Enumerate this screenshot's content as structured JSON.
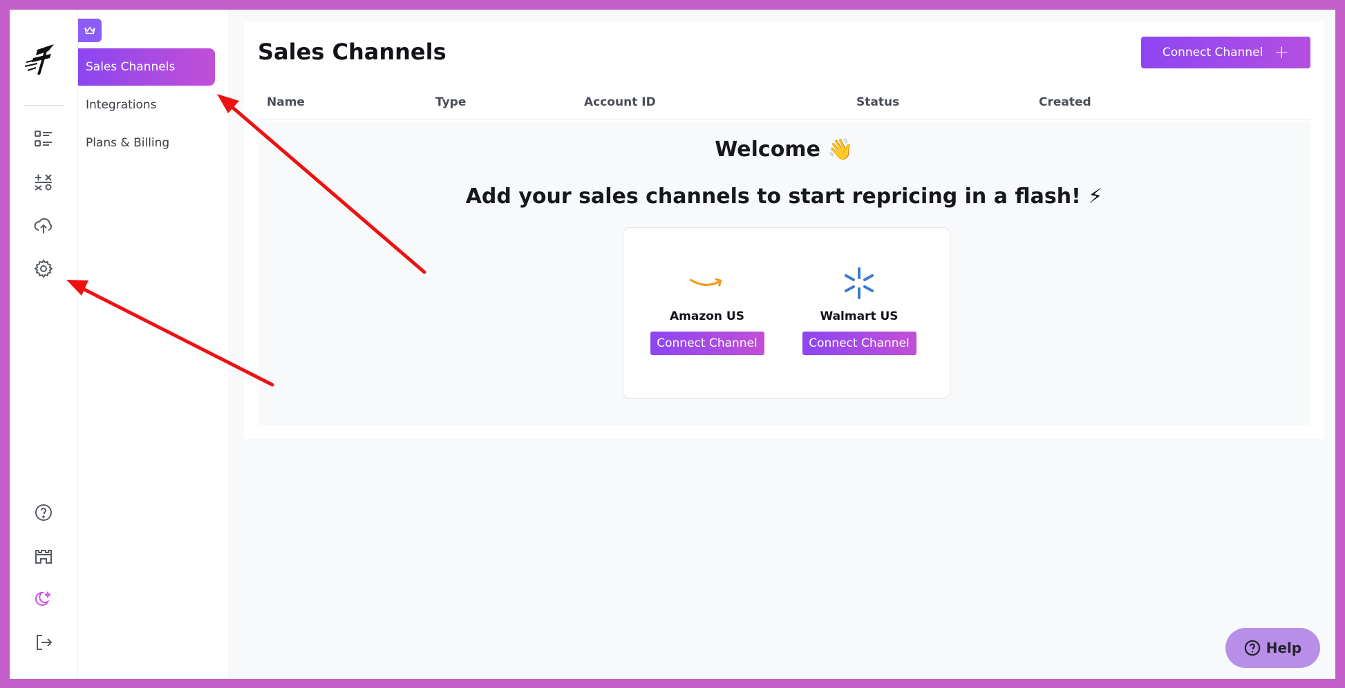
{
  "sidebar": {
    "icons": [
      "logo-icon",
      "list-icon",
      "calculator-icon",
      "upload-cloud-icon",
      "settings-gear-icon",
      "help-circle-icon",
      "castle-icon",
      "moon-icon",
      "logout-icon"
    ]
  },
  "submenu": {
    "items": [
      {
        "label": "Sales Channels",
        "active": true
      },
      {
        "label": "Integrations",
        "active": false
      },
      {
        "label": "Plans & Billing",
        "active": false
      }
    ]
  },
  "page": {
    "title": "Sales Channels",
    "connect_button_label": "Connect Channel"
  },
  "table": {
    "headers": [
      "Name",
      "Type",
      "Account ID",
      "Status",
      "Created"
    ]
  },
  "empty_state": {
    "welcome": "Welcome 👋",
    "tagline": "Add your sales channels to start repricing in a flash! ⚡",
    "channels": [
      {
        "name": "Amazon US",
        "button_label": "Connect Channel",
        "icon": "amazon-smile-icon"
      },
      {
        "name": "Walmart US",
        "button_label": "Connect Channel",
        "icon": "walmart-spark-icon"
      }
    ]
  },
  "help": {
    "label": "Help"
  },
  "colors": {
    "accent": "#8b46f0",
    "accent_end": "#c24fd6",
    "frame": "#c45ec9",
    "annotation_arrow": "#ee1111"
  }
}
